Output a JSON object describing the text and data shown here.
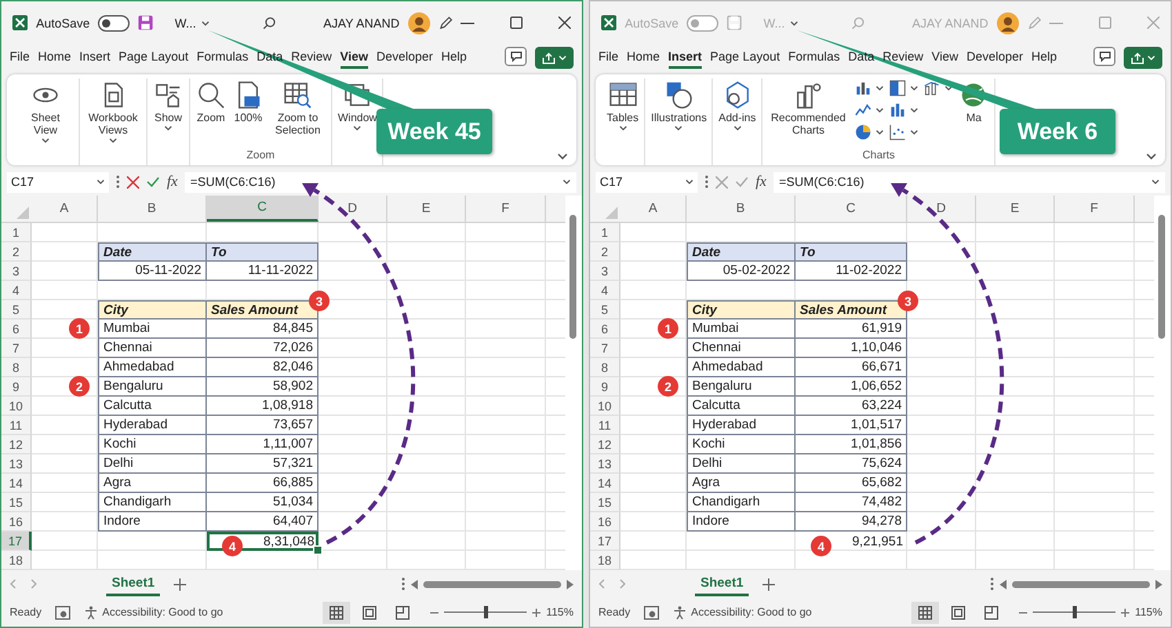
{
  "windows": [
    {
      "active": true,
      "title_bar": {
        "autosave_label": "AutoSave",
        "autosave_on": false,
        "file_name": "W...",
        "user_name": "AJAY ANAND"
      },
      "tabs": [
        {
          "label": "File",
          "selected": false
        },
        {
          "label": "Home",
          "selected": false
        },
        {
          "label": "Insert",
          "selected": false
        },
        {
          "label": "Page Layout",
          "selected": false
        },
        {
          "label": "Formulas",
          "selected": false
        },
        {
          "label": "Data",
          "selected": false
        },
        {
          "label": "Review",
          "selected": false
        },
        {
          "label": "View",
          "selected": true
        },
        {
          "label": "Developer",
          "selected": false
        },
        {
          "label": "Help",
          "selected": false
        }
      ],
      "ribbon": [
        {
          "buttons": [
            {
              "kind": "sheet-view",
              "label": "Sheet View",
              "dropdown": true
            }
          ]
        },
        {
          "buttons": [
            {
              "kind": "workbook-views",
              "label": "Workbook Views",
              "dropdown": true
            }
          ]
        },
        {
          "buttons": [
            {
              "kind": "show",
              "label": "Show",
              "dropdown": true
            }
          ]
        },
        {
          "label": "Zoom",
          "buttons": [
            {
              "kind": "zoom",
              "label": "Zoom",
              "dropdown": false
            },
            {
              "kind": "zoom-100",
              "label": "100%",
              "dropdown": false
            },
            {
              "kind": "zoom-selection",
              "label": "Zoom to Selection",
              "dropdown": false
            }
          ]
        },
        {
          "buttons": [
            {
              "kind": "window",
              "label": "Window",
              "dropdown": true
            }
          ]
        }
      ],
      "callout": "Week 45",
      "formula_bar": {
        "name_box": "C17",
        "function_label": "fx",
        "formula": "=SUM(C6:C16)"
      },
      "columns": [
        {
          "label": "A",
          "selected": false
        },
        {
          "label": "B",
          "selected": false
        },
        {
          "label": "C",
          "selected": true
        },
        {
          "label": "D",
          "selected": false
        },
        {
          "label": "E",
          "selected": false
        },
        {
          "label": "F",
          "selected": false
        }
      ],
      "rows": [
        {
          "label": "1",
          "selected": false
        },
        {
          "label": "2",
          "selected": false
        },
        {
          "label": "3",
          "selected": false
        },
        {
          "label": "4",
          "selected": false
        },
        {
          "label": "5",
          "selected": false
        },
        {
          "label": "6",
          "selected": false
        },
        {
          "label": "7",
          "selected": false
        },
        {
          "label": "8",
          "selected": false
        },
        {
          "label": "9",
          "selected": false
        },
        {
          "label": "10",
          "selected": false
        },
        {
          "label": "11",
          "selected": false
        },
        {
          "label": "12",
          "selected": false
        },
        {
          "label": "13",
          "selected": false
        },
        {
          "label": "14",
          "selected": false
        },
        {
          "label": "15",
          "selected": false
        },
        {
          "label": "16",
          "selected": false
        },
        {
          "label": "17",
          "selected": true
        },
        {
          "label": "18",
          "selected": false
        }
      ],
      "date_table": {
        "headers": [
          "Date",
          "To"
        ],
        "values": [
          "05-11-2022",
          "11-11-2022"
        ]
      },
      "sales_table": {
        "headers": [
          "City",
          "Sales Amount"
        ],
        "rows": [
          [
            "Mumbai",
            "84,845"
          ],
          [
            "Chennai",
            "72,026"
          ],
          [
            "Ahmedabad",
            "82,046"
          ],
          [
            "Bengaluru",
            "58,902"
          ],
          [
            "Calcutta",
            "1,08,918"
          ],
          [
            "Hyderabad",
            "73,657"
          ],
          [
            "Kochi",
            "1,11,007"
          ],
          [
            "Delhi",
            "57,321"
          ],
          [
            "Agra",
            "66,885"
          ],
          [
            "Chandigarh",
            "51,034"
          ],
          [
            "Indore",
            "64,407"
          ]
        ]
      },
      "total": {
        "value": "8,31,048",
        "selected": true
      },
      "markers": [
        "1",
        "2",
        "3",
        "4"
      ],
      "sheet_tabs": [
        {
          "label": "Sheet1",
          "selected": true
        }
      ],
      "status_bar": {
        "ready": "Ready",
        "accessibility": "Accessibility: Good to go",
        "views": [
          {
            "kind": "normal",
            "selected": true
          },
          {
            "kind": "page-layout",
            "selected": false
          },
          {
            "kind": "page-break",
            "selected": false
          }
        ],
        "zoom": {
          "level": 0.5
        },
        "zoom_label": "115%"
      }
    },
    {
      "active": false,
      "title_bar": {
        "autosave_label": "AutoSave",
        "autosave_on": false,
        "file_name": "W...",
        "user_name": "AJAY ANAND"
      },
      "tabs": [
        {
          "label": "File",
          "selected": false
        },
        {
          "label": "Home",
          "selected": false
        },
        {
          "label": "Insert",
          "selected": true
        },
        {
          "label": "Page Layout",
          "selected": false
        },
        {
          "label": "Formulas",
          "selected": false
        },
        {
          "label": "Data",
          "selected": false
        },
        {
          "label": "Review",
          "selected": false
        },
        {
          "label": "View",
          "selected": false
        },
        {
          "label": "Developer",
          "selected": false
        },
        {
          "label": "Help",
          "selected": false
        }
      ],
      "ribbon": [
        {
          "buttons": [
            {
              "kind": "table",
              "label": "Tables",
              "dropdown": true
            }
          ]
        },
        {
          "buttons": [
            {
              "kind": "shapes",
              "label": "Illustrations",
              "dropdown": true
            }
          ]
        },
        {
          "buttons": [
            {
              "kind": "add-ins",
              "label": "Add-ins",
              "dropdown": true
            }
          ]
        },
        {
          "label": "Charts",
          "buttons": [
            {
              "kind": "recommended-charts",
              "label": "Recommended Charts",
              "dropdown": false
            },
            {
              "kind": "chart-column",
              "dropdown": true
            },
            {
              "kind": "chart-line",
              "dropdown": true
            },
            {
              "kind": "chart-pie",
              "dropdown": true
            },
            {
              "kind": "chart-hierarchy",
              "dropdown": true
            },
            {
              "kind": "chart-bar",
              "dropdown": true
            },
            {
              "kind": "chart-scatter",
              "dropdown": true
            },
            {
              "kind": "chart-combo",
              "dropdown": true
            },
            {
              "kind": "globe",
              "label": "Ma",
              "dropdown": false
            }
          ]
        }
      ],
      "callout": "Week 6",
      "formula_bar": {
        "name_box": "C17",
        "function_label": "fx",
        "formula": "=SUM(C6:C16)"
      },
      "columns": [
        {
          "label": "A",
          "selected": false
        },
        {
          "label": "B",
          "selected": false
        },
        {
          "label": "C",
          "selected": false
        },
        {
          "label": "D",
          "selected": false
        },
        {
          "label": "E",
          "selected": false
        },
        {
          "label": "F",
          "selected": false
        }
      ],
      "rows": [
        {
          "label": "1",
          "selected": false
        },
        {
          "label": "2",
          "selected": false
        },
        {
          "label": "3",
          "selected": false
        },
        {
          "label": "4",
          "selected": false
        },
        {
          "label": "5",
          "selected": false
        },
        {
          "label": "6",
          "selected": false
        },
        {
          "label": "7",
          "selected": false
        },
        {
          "label": "8",
          "selected": false
        },
        {
          "label": "9",
          "selected": false
        },
        {
          "label": "10",
          "selected": false
        },
        {
          "label": "11",
          "selected": false
        },
        {
          "label": "12",
          "selected": false
        },
        {
          "label": "13",
          "selected": false
        },
        {
          "label": "14",
          "selected": false
        },
        {
          "label": "15",
          "selected": false
        },
        {
          "label": "16",
          "selected": false
        },
        {
          "label": "17",
          "selected": false
        },
        {
          "label": "18",
          "selected": false
        }
      ],
      "date_table": {
        "headers": [
          "Date",
          "To"
        ],
        "values": [
          "05-02-2022",
          "11-02-2022"
        ]
      },
      "sales_table": {
        "headers": [
          "City",
          "Sales Amount"
        ],
        "rows": [
          [
            "Mumbai",
            "61,919"
          ],
          [
            "Chennai",
            "1,10,046"
          ],
          [
            "Ahmedabad",
            "66,671"
          ],
          [
            "Bengaluru",
            "1,06,652"
          ],
          [
            "Calcutta",
            "63,224"
          ],
          [
            "Hyderabad",
            "1,01,517"
          ],
          [
            "Kochi",
            "1,01,856"
          ],
          [
            "Delhi",
            "75,624"
          ],
          [
            "Agra",
            "65,682"
          ],
          [
            "Chandigarh",
            "74,482"
          ],
          [
            "Indore",
            "94,278"
          ]
        ]
      },
      "total": {
        "value": "9,21,951",
        "selected": false
      },
      "markers": [
        "1",
        "2",
        "3",
        "4"
      ],
      "sheet_tabs": [
        {
          "label": "Sheet1",
          "selected": true
        }
      ],
      "status_bar": {
        "ready": "Ready",
        "accessibility": "Accessibility: Good to go",
        "views": [
          {
            "kind": "normal",
            "selected": true
          },
          {
            "kind": "page-layout",
            "selected": false
          },
          {
            "kind": "page-break",
            "selected": false
          }
        ],
        "zoom": {
          "level": 0.5
        },
        "zoom_label": "115%"
      }
    }
  ]
}
